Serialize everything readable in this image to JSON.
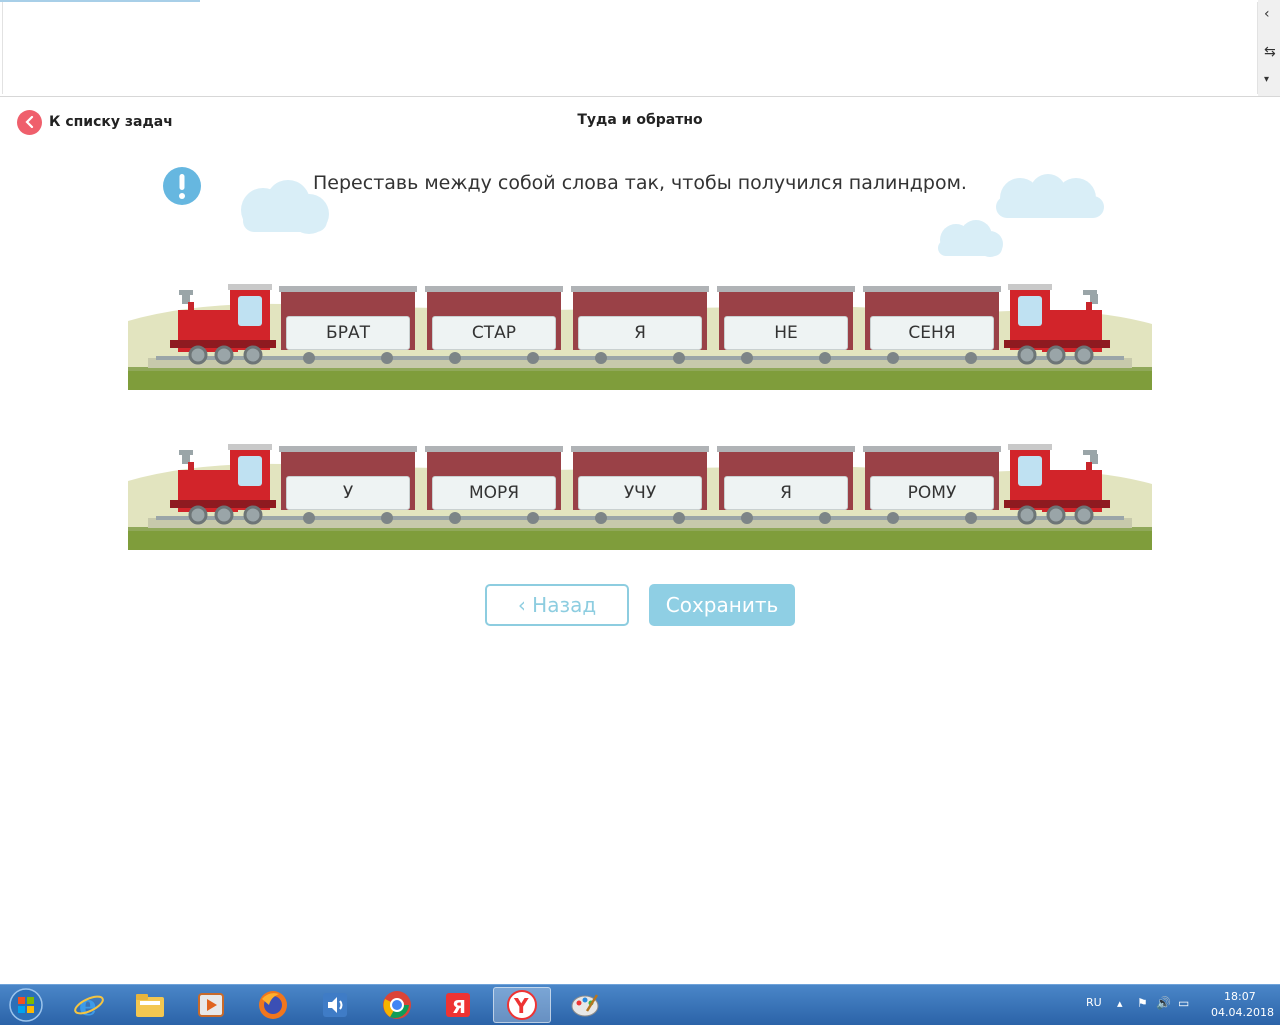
{
  "header": {
    "back_label": "К списку задач",
    "title": "Туда и обратно"
  },
  "instruction": "Переставь между собой слова так, чтобы получился палиндром.",
  "trains": [
    {
      "words": [
        "БРАТ",
        "СТАР",
        "Я",
        "НЕ",
        "СЕНЯ"
      ]
    },
    {
      "words": [
        "У",
        "МОРЯ",
        "УЧУ",
        "Я",
        "РОМУ"
      ]
    }
  ],
  "buttons": {
    "back": "‹ Назад",
    "save": "Сохранить"
  },
  "taskbar": {
    "language": "RU",
    "time": "18:07",
    "date": "04.04.2018",
    "apps": [
      "start-icon",
      "internet-explorer-icon",
      "file-explorer-icon",
      "media-player-icon",
      "firefox-icon",
      "audio-icon",
      "chrome-icon",
      "yandex-icon",
      "yandex-browser-icon",
      "paint-icon"
    ]
  },
  "colors": {
    "accent_red": "#ef5f6c",
    "button_blue": "#8dcde0",
    "locomotive_red": "#d2242a",
    "wagon_brown": "#9a4147"
  }
}
